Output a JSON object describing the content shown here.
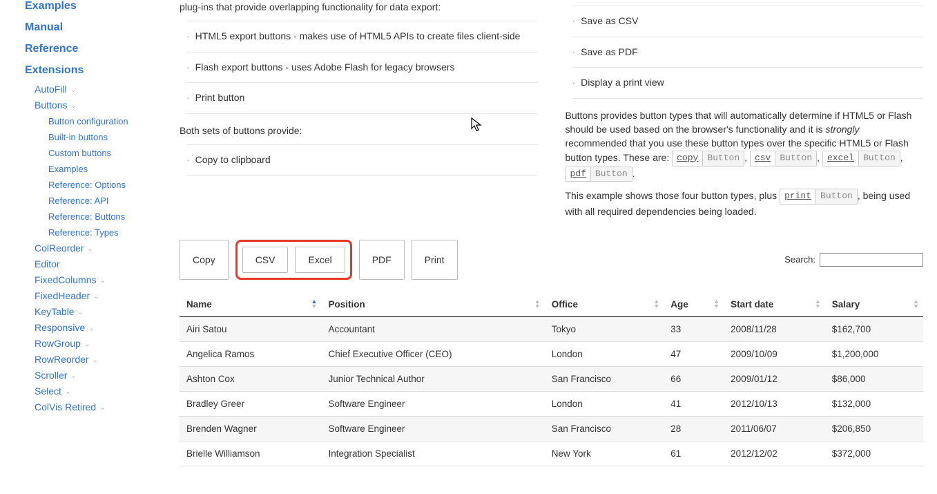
{
  "sidebar": {
    "top": [
      {
        "label": "Examples"
      },
      {
        "label": "Manual"
      },
      {
        "label": "Reference"
      },
      {
        "label": "Extensions"
      }
    ],
    "ext": [
      {
        "label": "AutoFill",
        "expand": true
      },
      {
        "label": "Buttons",
        "expand": true,
        "children": [
          {
            "label": "Button configuration"
          },
          {
            "label": "Built-in buttons"
          },
          {
            "label": "Custom buttons"
          },
          {
            "label": "Examples"
          },
          {
            "label": "Reference: Options"
          },
          {
            "label": "Reference: API"
          },
          {
            "label": "Reference: Buttons"
          },
          {
            "label": "Reference: Types"
          }
        ]
      },
      {
        "label": "ColReorder",
        "expand": true
      },
      {
        "label": "Editor"
      },
      {
        "label": "FixedColumns",
        "expand": true
      },
      {
        "label": "FixedHeader",
        "expand": true
      },
      {
        "label": "KeyTable",
        "expand": true
      },
      {
        "label": "Responsive",
        "expand": true
      },
      {
        "label": "RowGroup",
        "expand": true
      },
      {
        "label": "RowReorder",
        "expand": true
      },
      {
        "label": "Scroller",
        "expand": true
      },
      {
        "label": "Select",
        "expand": true
      },
      {
        "label": "ColVis Retired",
        "expand": true
      }
    ]
  },
  "left": {
    "intro_tail": "plug-ins that provide overlapping functionality for data export:",
    "list1": [
      "HTML5 export buttons - makes use of HTML5 APIs to create files client-side",
      "Flash export buttons - uses Adobe Flash for legacy browsers",
      "Print button"
    ],
    "both_provide": "Both sets of buttons provide:",
    "list2": [
      "Copy to clipboard"
    ]
  },
  "right": {
    "list1": [
      "Save as CSV",
      "Save as PDF",
      "Display a print view"
    ],
    "p1a": "Buttons provides button types that will automatically determine if HTML5 or Flash should be used based on the browser's functionality and it is ",
    "p1em": "strongly",
    "p1b": " recommended that you use these button types over the specific HTML5 or Flash button types. These are:",
    "codes": [
      {
        "c1": "copy",
        "c2": "Button"
      },
      {
        "c1": "csv",
        "c2": "Button"
      },
      {
        "c1": "excel",
        "c2": "Button"
      },
      {
        "c1": "pdf",
        "c2": "Button"
      }
    ],
    "p2a": "This example shows those four button types, plus ",
    "code_print": {
      "c1": "print",
      "c2": "Button"
    },
    "p2b": ", being used with all required dependencies being loaded."
  },
  "buttons": {
    "copy": "Copy",
    "csv": "CSV",
    "excel": "Excel",
    "pdf": "PDF",
    "print": "Print"
  },
  "search": {
    "label": "Search:",
    "value": ""
  },
  "table": {
    "headers": [
      "Name",
      "Position",
      "Office",
      "Age",
      "Start date",
      "Salary"
    ],
    "sorted_col": 0,
    "rows": [
      [
        "Airi Satou",
        "Accountant",
        "Tokyo",
        "33",
        "2008/11/28",
        "$162,700"
      ],
      [
        "Angelica Ramos",
        "Chief Executive Officer (CEO)",
        "London",
        "47",
        "2009/10/09",
        "$1,200,000"
      ],
      [
        "Ashton Cox",
        "Junior Technical Author",
        "San Francisco",
        "66",
        "2009/01/12",
        "$86,000"
      ],
      [
        "Bradley Greer",
        "Software Engineer",
        "London",
        "41",
        "2012/10/13",
        "$132,000"
      ],
      [
        "Brenden Wagner",
        "Software Engineer",
        "San Francisco",
        "28",
        "2011/06/07",
        "$206,850"
      ],
      [
        "Brielle Williamson",
        "Integration Specialist",
        "New York",
        "61",
        "2012/12/02",
        "$372,000"
      ]
    ]
  },
  "separators": {
    "comma": ", ",
    "period": "."
  }
}
